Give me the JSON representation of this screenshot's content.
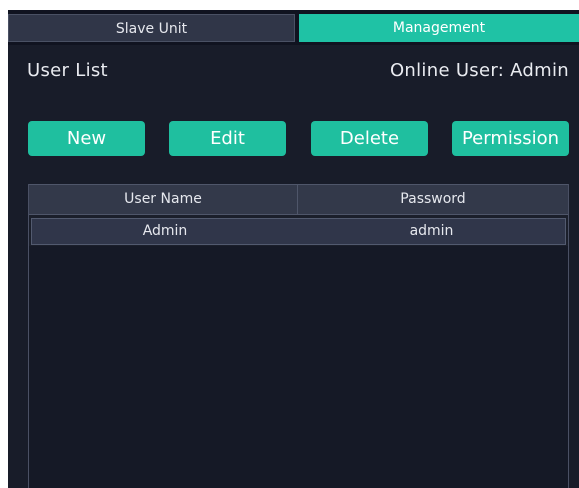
{
  "tabs": [
    {
      "label": "Slave Unit",
      "active": false
    },
    {
      "label": "Management",
      "active": true
    }
  ],
  "section": {
    "title": "User List",
    "online_user": "Online User: Admin"
  },
  "toolbar": {
    "new_label": "New",
    "edit_label": "Edit",
    "delete_label": "Delete",
    "permission_label": "Permission"
  },
  "table": {
    "columns": [
      "User Name",
      "Password"
    ],
    "rows": [
      {
        "user_name": "Admin",
        "password": "admin"
      }
    ]
  },
  "colors": {
    "accent": "#1fc2a5",
    "background": "#181c29",
    "header": "#33394a"
  }
}
